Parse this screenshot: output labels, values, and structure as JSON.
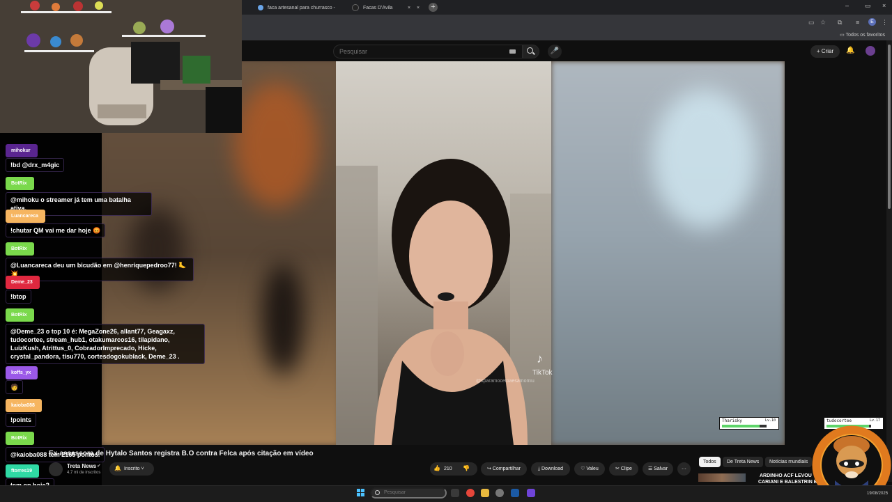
{
  "browser": {
    "tabs": [
      {
        "title": "faca artesanal para churrasco - ",
        "close": "×"
      },
      {
        "title": "Facas D'Avila",
        "close": "×"
      }
    ],
    "new_tab": "+",
    "window_controls": {
      "minimize": "–",
      "maximize": "▭",
      "close": "×"
    },
    "toolbar_icons": {
      "cast": "▭",
      "star": "☆",
      "extensions": "⧉",
      "tab_search": "≡",
      "profile": "E",
      "menu": "⋮"
    },
    "favorites_label": "Todos os favoritos"
  },
  "youtube": {
    "search_placeholder": "Pesquisar",
    "mic_icon": "🎤",
    "create_label": "+ Criar",
    "bell_icon": "🔔",
    "video": {
      "title": "Ex-assessora de Hytalo Santos registra B.O contra Felca após citação em vídeo",
      "tiktok_logo": "♪",
      "tiktok_label": "TikTok",
      "tiktok_handle": "@sparamocetoaesamomiu"
    },
    "channel": {
      "name": "Treta News",
      "verified": "✔",
      "subs": "4,7 mi de inscritos"
    },
    "subscribe_label": "Inscrito ˅",
    "subscribe_bell": "🔔",
    "actions": {
      "like_icon": "👍",
      "like_count": "210",
      "dislike_icon": "👎",
      "share": "↪ Compartilhar",
      "download": "⤓ Download",
      "thanks": "♡ Valeu",
      "clip": "✂ Clipe",
      "save": "☰ Salvar",
      "more": "···"
    },
    "chips": [
      "Todos",
      "De Treta News",
      "Notícias mundiais"
    ],
    "recommended_line1": "ARDINHO ACF LEVOU",
    "recommended_line2": "CARIANI E BALESTRIN EM"
  },
  "chat": {
    "messages": [
      {
        "user": "mihokur",
        "color": "#6a2ea5",
        "text": "!bd @drx_m4gic"
      },
      {
        "user": "BotRix",
        "color": "#7ad94c",
        "text": "@mihoku o streamer já tem uma batalha ativa."
      },
      {
        "user": "Luancareca",
        "color": "#f6b560",
        "text": "!chutar QM vai me dar hoje 😡"
      },
      {
        "user": "BotRix",
        "color": "#7ad94c",
        "text": "@Luancareca deu um bicudão em @henriquepedroo77! 🦶💥"
      },
      {
        "user": "Deme_23",
        "color": "#e0283f",
        "text": "!btop"
      },
      {
        "user": "BotRix",
        "color": "#7ad94c",
        "text": "@Deme_23 o top 10 é: MegaZone26, allant77, Geagaxz, tudocortee, stream_hub1, otakumarcos16, tilapidano, LuizKush, Atrittus_0, CobradorImprecado, Hicke, crystal_pandora, tisu770, cortesdogokublack, Deme_23 ."
      },
      {
        "user": "koffs_yx",
        "color": "#9b59e8",
        "text": "🧑"
      },
      {
        "user": "kaioba088",
        "color": "#f6b560",
        "text": "!points"
      },
      {
        "user": "BotRix",
        "color": "#7ad94c",
        "text": "@kaioba088 tem 2165 pontos."
      },
      {
        "user": "ftorres19",
        "color": "#2fd9a5",
        "text": "tem op hoje?"
      }
    ]
  },
  "game": {
    "player_a": {
      "name": "Tharisky",
      "level": "Lv.10",
      "hp": 0.85
    },
    "player_b": {
      "name": "tudocortee",
      "level": "Lv.17",
      "hp": 0.95
    }
  },
  "taskbar": {
    "search_placeholder": "Pesquisar",
    "date": "19/08/2025"
  }
}
